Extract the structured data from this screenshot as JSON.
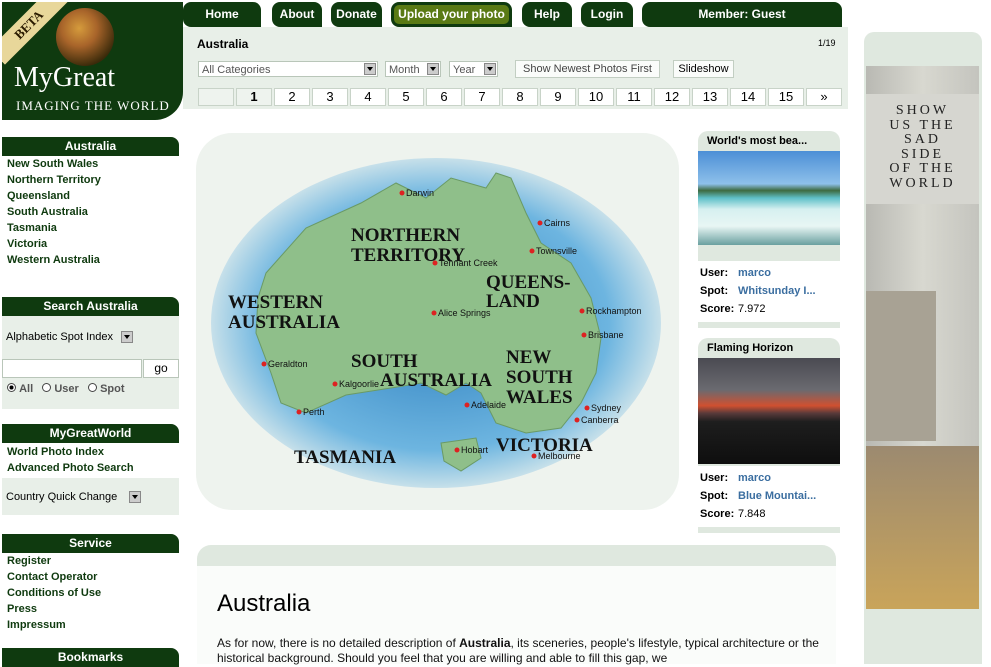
{
  "logo": {
    "beta": "BETA",
    "title": "MyGreat",
    "subtitle": "IMAGING THE WORLD"
  },
  "nav": {
    "home": "Home",
    "about": "About",
    "donate": "Donate",
    "upload": "Upload your photo",
    "help": "Help",
    "login": "Login",
    "member": "Member: Guest"
  },
  "header": {
    "title": "Australia",
    "page_counter": "1/19",
    "categories": "All Categories",
    "month": "Month",
    "year": "Year",
    "newest": "Show Newest Photos First",
    "slideshow": "Slideshow",
    "pages": [
      "1",
      "2",
      "3",
      "4",
      "5",
      "6",
      "7",
      "8",
      "9",
      "10",
      "11",
      "12",
      "13",
      "14",
      "15"
    ],
    "next": "»"
  },
  "sidebar": {
    "region_head": "Australia",
    "regions": [
      "New South Wales",
      "Northern Territory",
      "Queensland",
      "South Australia",
      "Tasmania",
      "Victoria",
      "Western Australia"
    ],
    "search_head": "Search Australia",
    "spot_index": "Alphabetic Spot Index",
    "go": "go",
    "radio_all": "All",
    "radio_user": "User",
    "radio_spot": "Spot",
    "world_head": "MyGreatWorld",
    "world_links": [
      "World Photo Index",
      "Advanced Photo Search"
    ],
    "country_change": "Country Quick Change",
    "service_head": "Service",
    "service_links": [
      "Register",
      "Contact Operator",
      "Conditions of Use",
      "Press",
      "Impressum"
    ],
    "bookmarks_head": "Bookmarks"
  },
  "map": {
    "regions": [
      "NORTHERN",
      "TERRITORY",
      "WESTERN",
      "AUSTRALIA",
      "QUEENS-",
      "LAND",
      "SOUTH",
      "AUSTRALIA",
      "NEW",
      "SOUTH",
      "WALES",
      "VICTORIA",
      "TASMANIA"
    ],
    "cities": [
      "Darwin",
      "Cairns",
      "Townsville",
      "Tennant Creek",
      "Alice Springs",
      "Rockhampton",
      "Brisbane",
      "Geraldton",
      "Kalgoorlie",
      "Perth",
      "Adelaide",
      "Sydney",
      "Canberra",
      "Melbourne",
      "Hobart"
    ]
  },
  "cards": [
    {
      "title": "World's most bea...",
      "user_label": "User:",
      "user": "marco",
      "spot_label": "Spot:",
      "spot": "Whitsunday I...",
      "score_label": "Score:",
      "score": "7.972"
    },
    {
      "title": "Flaming Horizon",
      "user_label": "User:",
      "user": "marco",
      "spot_label": "Spot:",
      "spot": "Blue Mountai...",
      "score_label": "Score:",
      "score": "7.848"
    }
  ],
  "banner": {
    "lines": [
      "SHOW",
      "US THE",
      "SAD",
      "SIDE",
      "OF THE",
      "WORLD"
    ]
  },
  "description": {
    "title": "Australia",
    "text_before": "As for now, there is no detailed description of ",
    "text_bold": "Australia",
    "text_after": ", its sceneries, people's lifestyle, typical architecture or the historical background. Should you feel that you are willing and able to fill this gap, we"
  },
  "colors": {
    "dark_green": "#0f3a0f",
    "panel": "#e8efe8",
    "link_blue": "#3b6ea0",
    "upload_green": "#5a7a14"
  }
}
